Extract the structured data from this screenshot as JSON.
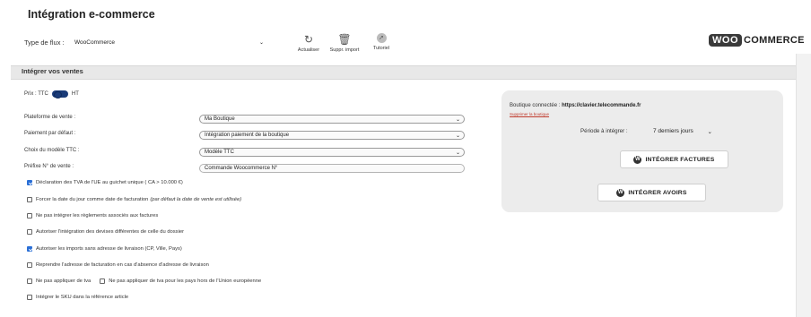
{
  "page": {
    "title": "Intégration e-commerce"
  },
  "brand": {
    "woo": "WOO",
    "commerce": "COMMERCE"
  },
  "flux": {
    "label": "Type de flux :",
    "value": "WooCommerce"
  },
  "toolbar": {
    "refresh_label": "Actualiser",
    "delete_label": "Suppr. import",
    "tutorial_label": "Tutoriel"
  },
  "section": {
    "title": "Intégrer vos ventes"
  },
  "prix": {
    "ttc": "Prix : TTC",
    "ht": "HT"
  },
  "form": {
    "platform": {
      "label": "Plateforme de vente :",
      "value": "Ma Boutique"
    },
    "payment": {
      "label": "Paiement par défaut :",
      "value": "Intégration paiement de la boutique"
    },
    "model": {
      "label": "Choix du modèle TTC :",
      "value": "Modèle TTC"
    },
    "prefix": {
      "label": "Préfixe N° de vente :",
      "value": "Commande Woocommerce N°"
    }
  },
  "options": [
    {
      "label": "Déclaration des TVA de l'UE au guichet unique ( CA > 10.000 €)",
      "checked": true
    },
    {
      "label": "Forcer la date du jour comme date de facturation",
      "note": "(par défaut la date de vente est utilisée)",
      "checked": false
    },
    {
      "label": "Ne pas intégrer les règlements associés aux factures",
      "checked": false
    },
    {
      "label": "Autoriser l'intégration des devises différentes de celle du dossier",
      "checked": false
    },
    {
      "label": "Autoriser les imports sans adresse de livraison (CP, Ville, Pays)",
      "checked": true
    },
    {
      "label": "Reprendre l'adresse de facturation en cas d'absence d'adresse de livraison",
      "checked": false
    },
    {
      "label": "Ne pas appliquer de tva",
      "checked": false
    },
    {
      "label": "Ne pas appliquer de tva pour les pays hors de l'Union européenne",
      "checked": false
    },
    {
      "label": "Intégrer le SKU dans la référence article",
      "checked": false
    }
  ],
  "panel": {
    "connected_label": "Boutique connectée :",
    "connected_url": "https://clavier.telecommande.fr",
    "remove_link": "Supprimer la boutique",
    "period_label": "Période à intégrer :",
    "period_value": "7 derniers jours",
    "btn_factures": "INTÉGRER FACTURES",
    "btn_avoirs": "INTÉGRER AVOIRS"
  },
  "colors": {
    "toggle": "#1a3b78",
    "checkbox": "#2a6fd6",
    "link": "#c0392b",
    "panel_bg": "#ececec"
  }
}
